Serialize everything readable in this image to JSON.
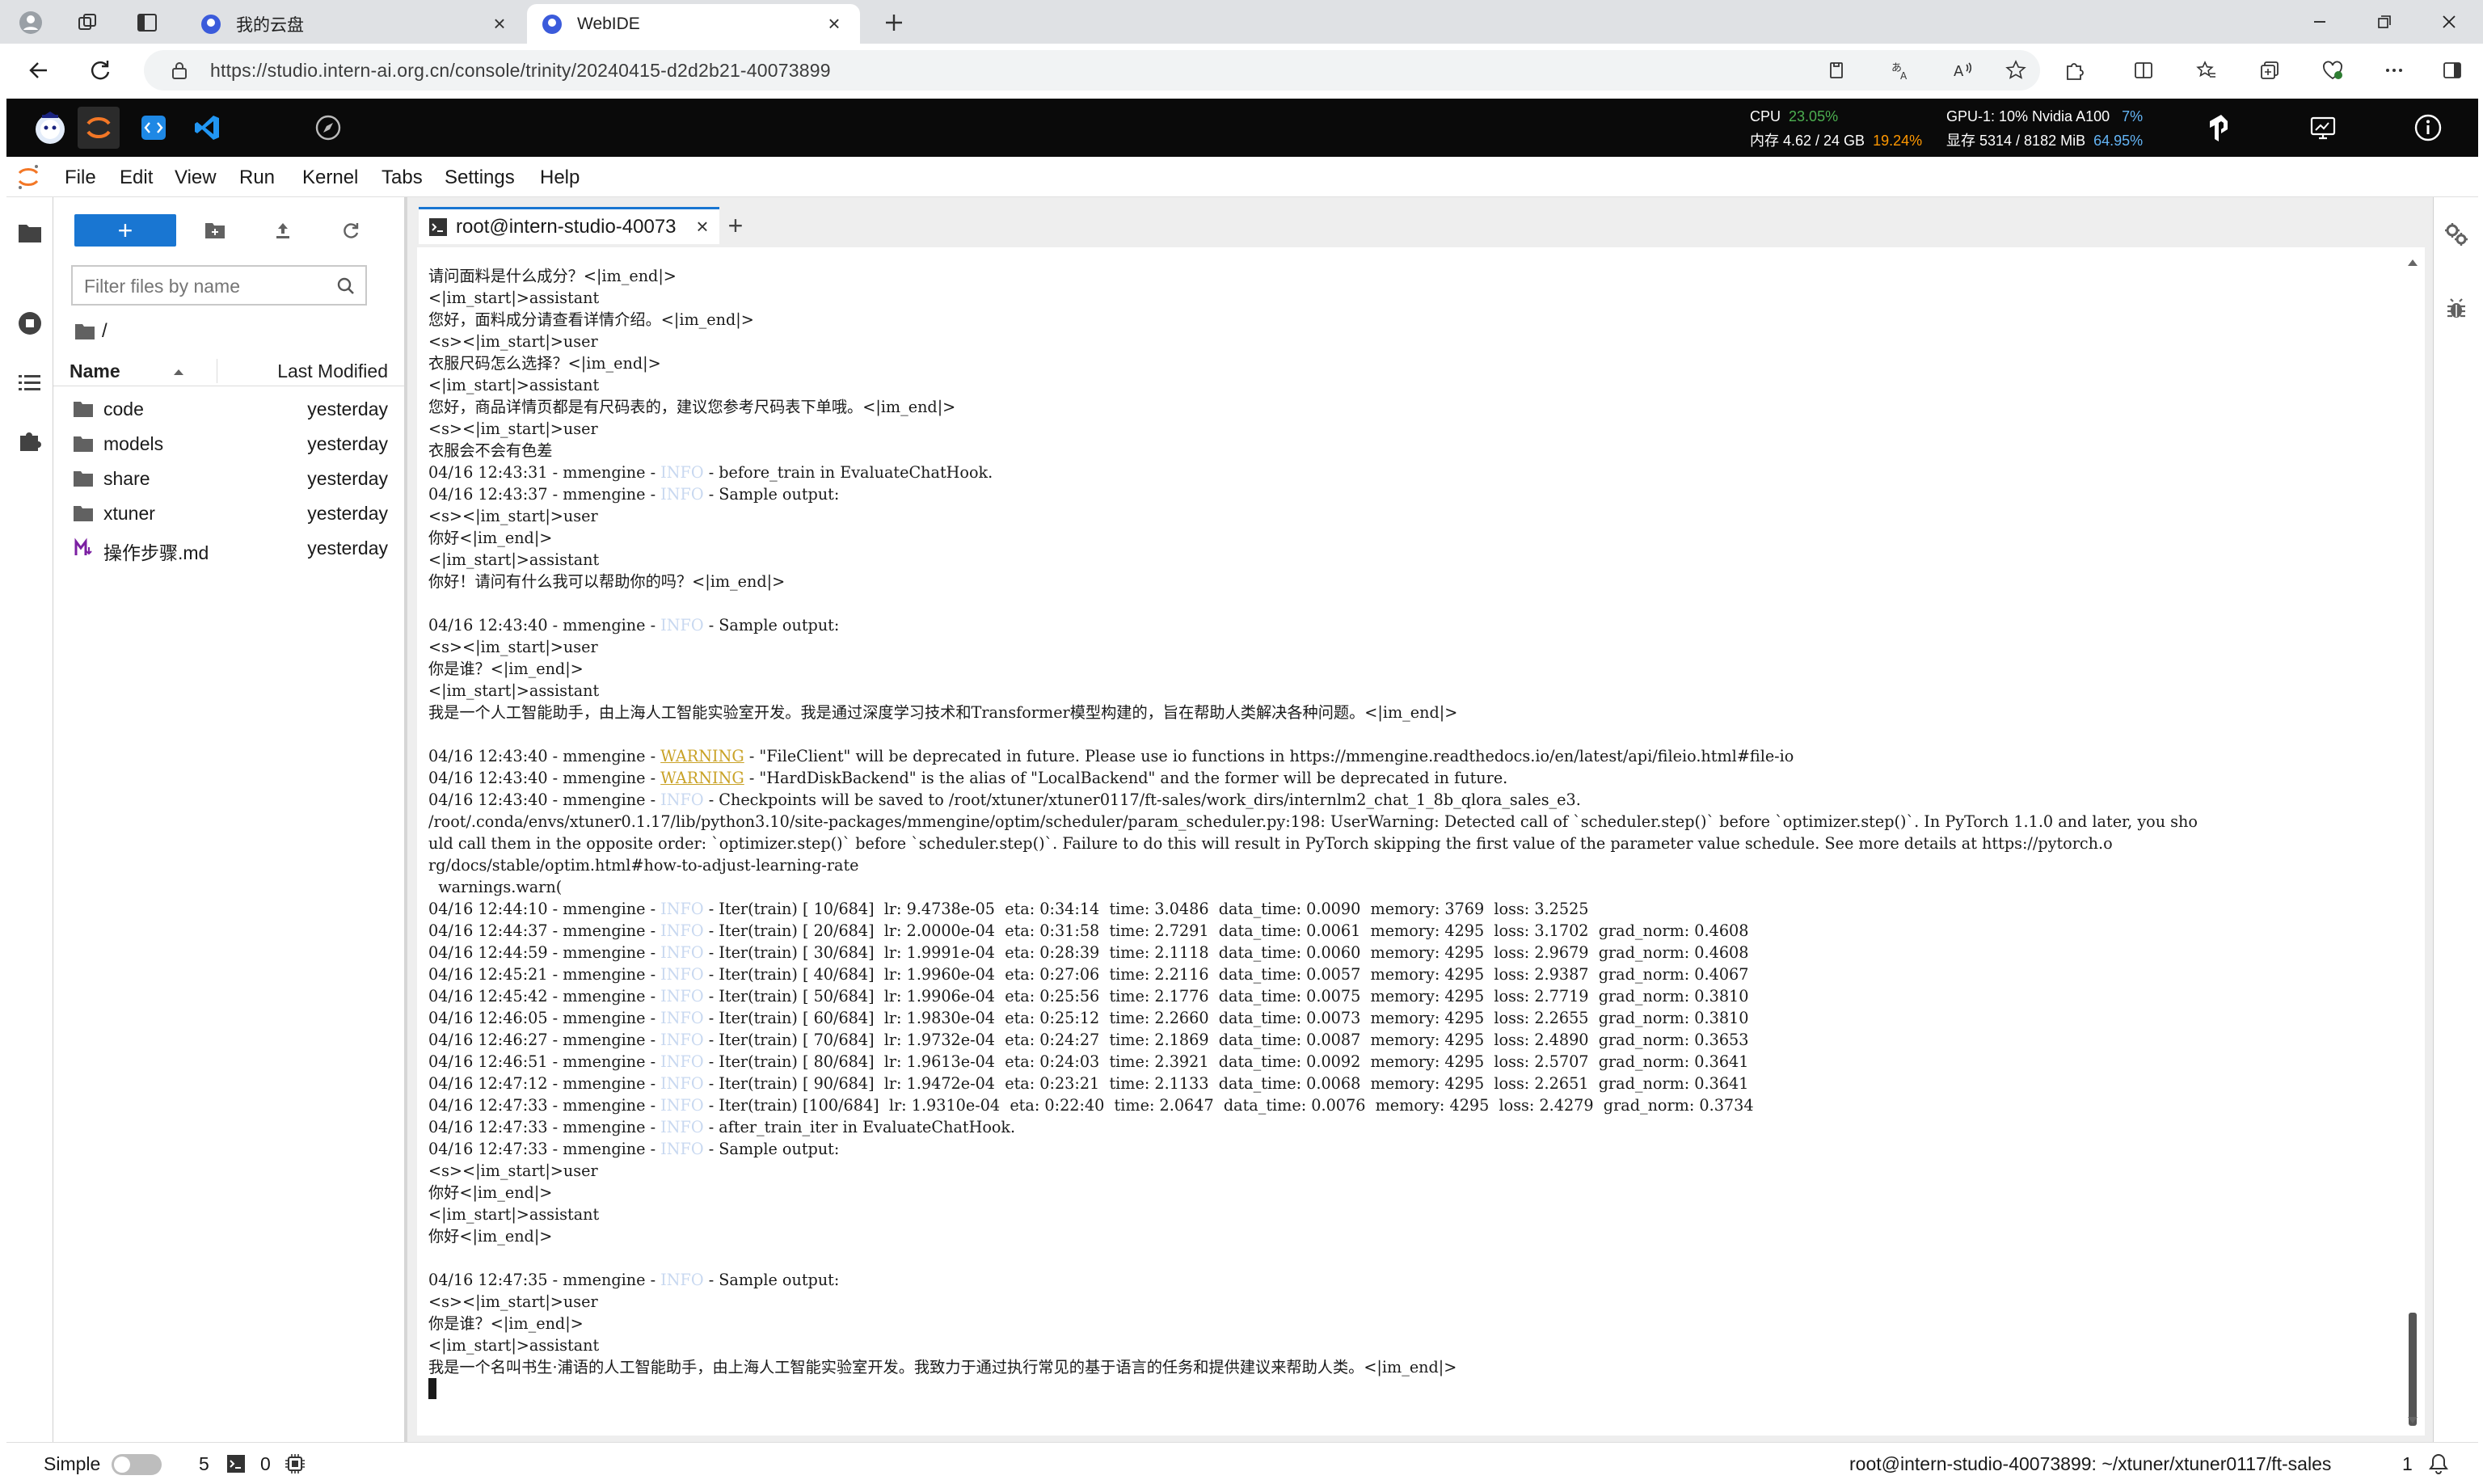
{
  "browser": {
    "tabs": [
      {
        "title": "我的云盘",
        "active": false
      },
      {
        "title": "WebIDE",
        "active": true
      }
    ],
    "url": "https://studio.intern-ai.org.cn/console/trinity/20240415-d2d2b21-40073899"
  },
  "resources": {
    "cpu_label": "CPU",
    "cpu_value": "23.05%",
    "mem_label": "内存 4.62 / 24 GB",
    "mem_value": "19.24%",
    "gpu_label": "GPU-1: 10% Nvidia A100",
    "gpu_value": "7%",
    "vram_label": "显存 5314 / 8182 MiB",
    "vram_value": "64.95%"
  },
  "menu": [
    "File",
    "Edit",
    "View",
    "Run",
    "Kernel",
    "Tabs",
    "Settings",
    "Help"
  ],
  "filebrowser": {
    "new_label": "+",
    "filter_placeholder": "Filter files by name",
    "breadcrumb": "/",
    "col_name": "Name",
    "col_modified": "Last Modified",
    "files": [
      {
        "name": "code",
        "modified": "yesterday",
        "type": "folder"
      },
      {
        "name": "models",
        "modified": "yesterday",
        "type": "folder"
      },
      {
        "name": "share",
        "modified": "yesterday",
        "type": "folder"
      },
      {
        "name": "xtuner",
        "modified": "yesterday",
        "type": "folder"
      },
      {
        "name": "操作步骤.md",
        "modified": "yesterday",
        "type": "markdown"
      }
    ]
  },
  "terminal": {
    "tab_label": "root@intern-studio-40073",
    "lines": [
      "请问面料是什么成分？<|im_end|>",
      "<|im_start|>assistant",
      "您好，面料成分请查看详情介绍。<|im_end|>",
      "<s><|im_start|>user",
      "衣服尺码怎么选择？<|im_end|>",
      "<|im_start|>assistant",
      "您好，商品详情页都是有尺码表的，建议您参考尺码表下单哦。<|im_end|>",
      "<s><|im_start|>user",
      "衣服会不会有色差",
      "04/16 12:43:31 - mmengine - INFO - before_train in EvaluateChatHook.",
      "04/16 12:43:37 - mmengine - INFO - Sample output:",
      "<s><|im_start|>user",
      "你好<|im_end|>",
      "<|im_start|>assistant",
      "你好！请问有什么我可以帮助你的吗？<|im_end|>",
      "",
      "04/16 12:43:40 - mmengine - INFO - Sample output:",
      "<s><|im_start|>user",
      "你是谁？<|im_end|>",
      "<|im_start|>assistant",
      "我是一个人工智能助手，由上海人工智能实验室开发。我是通过深度学习技术和Transformer模型构建的，旨在帮助人类解决各种问题。<|im_end|>",
      "",
      "04/16 12:43:40 - mmengine - WARNING - \"FileClient\" will be deprecated in future. Please use io functions in https://mmengine.readthedocs.io/en/latest/api/fileio.html#file-io",
      "04/16 12:43:40 - mmengine - WARNING - \"HardDiskBackend\" is the alias of \"LocalBackend\" and the former will be deprecated in future.",
      "04/16 12:43:40 - mmengine - INFO - Checkpoints will be saved to /root/xtuner/xtuner0117/ft-sales/work_dirs/internlm2_chat_1_8b_qlora_sales_e3.",
      "/root/.conda/envs/xtuner0.1.17/lib/python3.10/site-packages/mmengine/optim/scheduler/param_scheduler.py:198: UserWarning: Detected call of `scheduler.step()` before `optimizer.step()`. In PyTorch 1.1.0 and later, you sho",
      "uld call them in the opposite order: `optimizer.step()` before `scheduler.step()`. Failure to do this will result in PyTorch skipping the first value of the parameter value schedule. See more details at https://pytorch.o",
      "rg/docs/stable/optim.html#how-to-adjust-learning-rate",
      "  warnings.warn(",
      "04/16 12:44:10 - mmengine - INFO - Iter(train) [ 10/684]  lr: 9.4738e-05  eta: 0:34:14  time: 3.0486  data_time: 0.0090  memory: 3769  loss: 3.2525",
      "04/16 12:44:37 - mmengine - INFO - Iter(train) [ 20/684]  lr: 2.0000e-04  eta: 0:31:58  time: 2.7291  data_time: 0.0061  memory: 4295  loss: 3.1702  grad_norm: 0.4608",
      "04/16 12:44:59 - mmengine - INFO - Iter(train) [ 30/684]  lr: 1.9991e-04  eta: 0:28:39  time: 2.1118  data_time: 0.0060  memory: 4295  loss: 2.9679  grad_norm: 0.4608",
      "04/16 12:45:21 - mmengine - INFO - Iter(train) [ 40/684]  lr: 1.9960e-04  eta: 0:27:06  time: 2.2116  data_time: 0.0057  memory: 4295  loss: 2.9387  grad_norm: 0.4067",
      "04/16 12:45:42 - mmengine - INFO - Iter(train) [ 50/684]  lr: 1.9906e-04  eta: 0:25:56  time: 2.1776  data_time: 0.0075  memory: 4295  loss: 2.7719  grad_norm: 0.3810",
      "04/16 12:46:05 - mmengine - INFO - Iter(train) [ 60/684]  lr: 1.9830e-04  eta: 0:25:12  time: 2.2660  data_time: 0.0073  memory: 4295  loss: 2.2655  grad_norm: 0.3810",
      "04/16 12:46:27 - mmengine - INFO - Iter(train) [ 70/684]  lr: 1.9732e-04  eta: 0:24:27  time: 2.1869  data_time: 0.0087  memory: 4295  loss: 2.4890  grad_norm: 0.3653",
      "04/16 12:46:51 - mmengine - INFO - Iter(train) [ 80/684]  lr: 1.9613e-04  eta: 0:24:03  time: 2.3921  data_time: 0.0092  memory: 4295  loss: 2.5707  grad_norm: 0.3641",
      "04/16 12:47:12 - mmengine - INFO - Iter(train) [ 90/684]  lr: 1.9472e-04  eta: 0:23:21  time: 2.1133  data_time: 0.0068  memory: 4295  loss: 2.2651  grad_norm: 0.3641",
      "04/16 12:47:33 - mmengine - INFO - Iter(train) [100/684]  lr: 1.9310e-04  eta: 0:22:40  time: 2.0647  data_time: 0.0076  memory: 4295  loss: 2.4279  grad_norm: 0.3734",
      "04/16 12:47:33 - mmengine - INFO - after_train_iter in EvaluateChatHook.",
      "04/16 12:47:33 - mmengine - INFO - Sample output:",
      "<s><|im_start|>user",
      "你好<|im_end|>",
      "<|im_start|>assistant",
      "你好<|im_end|>",
      "",
      "04/16 12:47:35 - mmengine - INFO - Sample output:",
      "<s><|im_start|>user",
      "你是谁？<|im_end|>",
      "<|im_start|>assistant",
      "我是一个名叫书生·浦语的人工智能助手，由上海人工智能实验室开发。我致力于通过执行常见的基于语言的任务和提供建议来帮助人类。<|im_end|>",
      ""
    ]
  },
  "statusbar": {
    "mode_label": "Simple",
    "terminals_count": "5",
    "kernels_count": "0",
    "path": "root@intern-studio-40073899: ~/xtuner/xtuner0117/ft-sales",
    "notifications": "1"
  },
  "colors": {
    "accent": "#1976d2",
    "warning": "#c9a227",
    "info": "#c8d8f0",
    "topbar": "#0a0a0a"
  }
}
